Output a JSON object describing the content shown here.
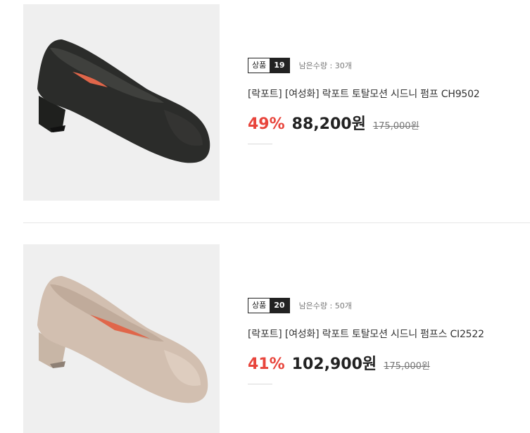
{
  "products": [
    {
      "badge_label": "상품",
      "badge_number": "19",
      "stock": "남은수량 : 30개",
      "title": "[락포트] [여성화] 락포트 토탈모션 시드니 펌프 CH9502",
      "discount": "49%",
      "price": "88,200원",
      "original_price": "175,000원",
      "shoe_color": "#2b2c2a"
    },
    {
      "badge_label": "상품",
      "badge_number": "20",
      "stock": "남은수량 : 50개",
      "title": "[락포트] [여성화] 락포트 토탈모션 시드니 펌프스 CI2522",
      "discount": "41%",
      "price": "102,900원",
      "original_price": "175,000원",
      "shoe_color": "#d2bfb0"
    }
  ],
  "colors": {
    "discount": "#e8453c",
    "insole_accent": "#e0664a"
  }
}
